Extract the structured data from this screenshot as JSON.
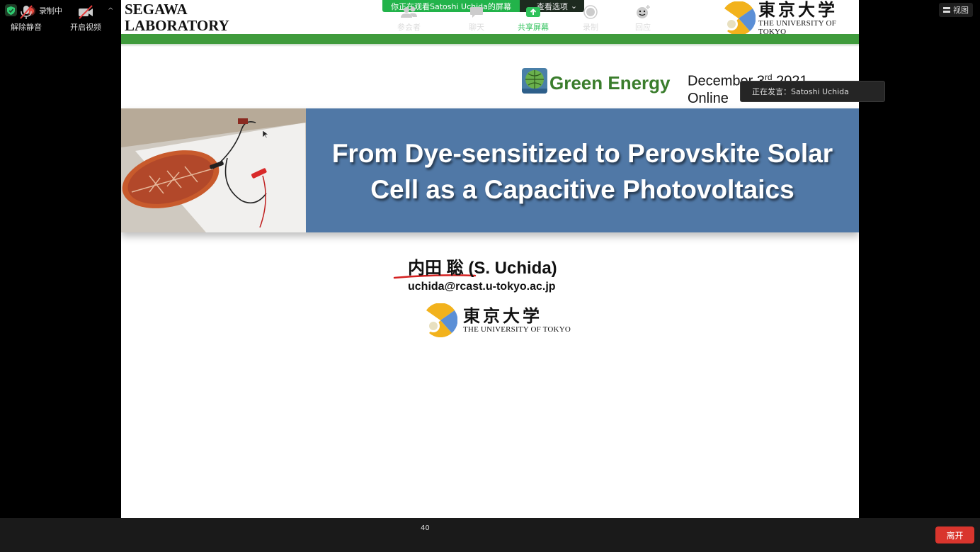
{
  "status": {
    "recording_label": "录制中",
    "view_label": "视图"
  },
  "share_banner": {
    "message": "你正在观看Satoshi  Uchida的屏幕",
    "options_label": "查看选项"
  },
  "speaking": {
    "label": "正在发言：Satoshi Uchida"
  },
  "slide": {
    "lab_logo_line1": "SEGAWA",
    "lab_logo_line2": "LABORATORY",
    "utokyo_jp": "東京大学",
    "utokyo_en": "THE UNIVERSITY OF TOKYO",
    "event_name": "Green Energy",
    "date_main": "December 3",
    "date_suffix": "rd",
    "date_year": " 2021",
    "date_mode": "Online",
    "title_line1": "From Dye-sensitized to Perovskite Solar",
    "title_line2": "Cell as a Capacitive Photovoltaics",
    "author": "内田 聡 (S. Uchida)",
    "email": "uchida@rcast.u-tokyo.ac.jp"
  },
  "toolbar": {
    "unmute": "解除静音",
    "start_video": "开启视频",
    "participants": "参会者",
    "participants_count": "40",
    "chat": "聊天",
    "share_screen": "共享屏幕",
    "record": "录制",
    "reactions": "回应",
    "leave": "离开"
  },
  "colors": {
    "share_green": "#22b34a",
    "lab_green": "#3f9b3c",
    "banner_blue": "#5078a6",
    "leave_red": "#d9352d"
  }
}
